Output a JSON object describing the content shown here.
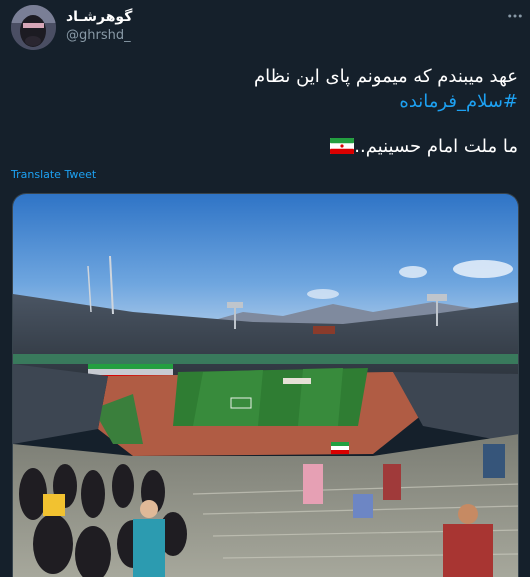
{
  "user": {
    "display_name": "گوهرشـاد",
    "handle": "@ghrshd_"
  },
  "tweet": {
    "line1": "عهد میبندم که میمونم پای این نظام",
    "hashtag": "#سلام_فرمانده",
    "line3": "ما ملت امام حسینیم..",
    "translate_label": "Translate Tweet"
  },
  "icons": {
    "more": "more-horizontal-icon",
    "flag": "iran-flag-icon"
  },
  "colors": {
    "background": "#15202b",
    "link": "#1da1f2",
    "secondary_text": "#8899a6"
  }
}
